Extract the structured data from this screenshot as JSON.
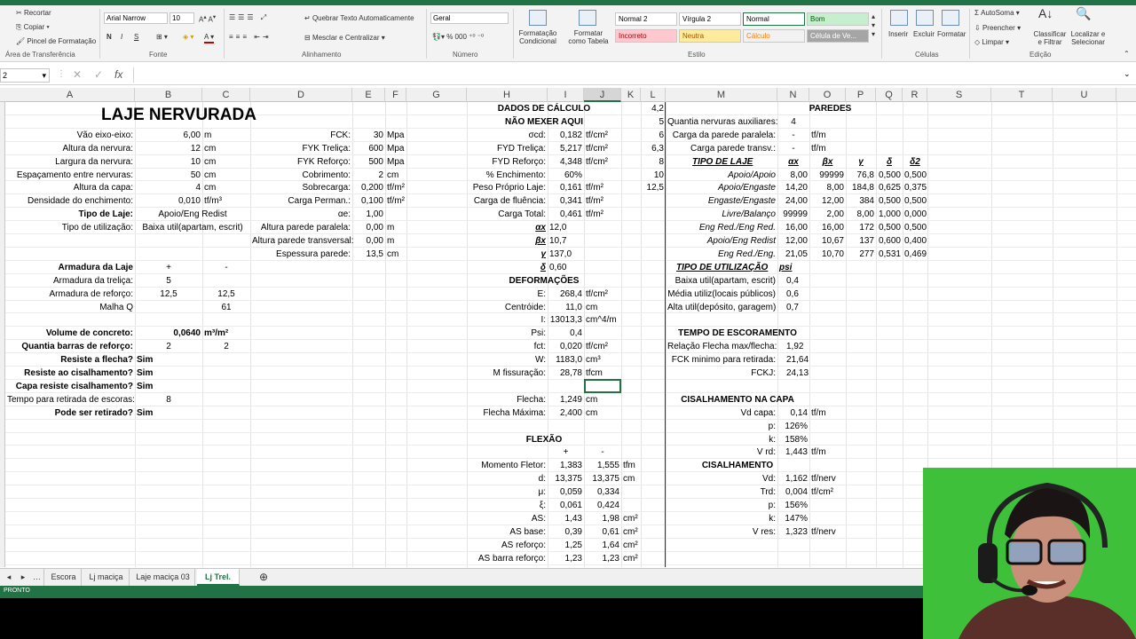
{
  "ribbon": {
    "clipboard": {
      "cut": "Recortar",
      "copy": "Copiar",
      "paste_fmt": "Pincel de Formatação",
      "label": "Área de Transferência"
    },
    "font": {
      "name": "Arial Narrow",
      "size": "10",
      "label": "Fonte",
      "bold": "N",
      "italic": "I",
      "underline": "S"
    },
    "alignment": {
      "wrap": "Quebrar Texto Automaticamente",
      "merge": "Mesclar e Centralizar",
      "label": "Alinhamento"
    },
    "number": {
      "format": "Geral",
      "percent": "%",
      "label": "Número"
    },
    "styles": {
      "cond": "Formatação Condicional",
      "table": "Formatar como Tabela",
      "label": "Estilo",
      "cells": [
        {
          "text": "Normal 2",
          "bg": "#ffffff",
          "fg": "#000000"
        },
        {
          "text": "Vírgula 2",
          "bg": "#ffffff",
          "fg": "#000000"
        },
        {
          "text": "Normal",
          "bg": "#ffffff",
          "fg": "#000000"
        },
        {
          "text": "Bom",
          "bg": "#c6efce",
          "fg": "#006100"
        },
        {
          "text": "Incorreto",
          "bg": "#ffc7ce",
          "fg": "#9c0006"
        },
        {
          "text": "Neutra",
          "bg": "#ffeb9c",
          "fg": "#9c5700"
        },
        {
          "text": "Cálculo",
          "bg": "#f2f2f2",
          "fg": "#fa7d00"
        },
        {
          "text": "Célula de Ve...",
          "bg": "#a5a5a5",
          "fg": "#ffffff"
        }
      ]
    },
    "cells_grp": {
      "insert": "Inserir",
      "delete": "Excluir",
      "format": "Formatar",
      "label": "Células"
    },
    "editing": {
      "autosum": "AutoSoma",
      "fill": "Preencher",
      "clear": "Limpar",
      "sort": "Classificar e Filtrar",
      "find": "Localizar e Selecionar",
      "label": "Edição"
    }
  },
  "formula_bar": {
    "namebox": "2",
    "fx": "fx",
    "content": ""
  },
  "columns": [
    "A",
    "B",
    "C",
    "D",
    "E",
    "F",
    "G",
    "H",
    "I",
    "J",
    "K",
    "L",
    "M",
    "N",
    "O",
    "P",
    "Q",
    "R",
    "S",
    "T",
    "U"
  ],
  "sheet": {
    "title": "LAJE NERVURADA",
    "left_labels": [
      "Vão eixo-eixo:",
      "Altura da nervura:",
      "Largura da nervura:",
      "Espaçamento entre nervuras:",
      "Altura da capa:",
      "Densidade do enchimento:",
      "Tipo de Laje:",
      "Tipo de utilização:"
    ],
    "left_values": [
      "6,00",
      "12",
      "10",
      "50",
      "4",
      "0,010",
      "Apoio/Eng Redist",
      "Baixa util(apartam, escrit)"
    ],
    "left_units": [
      "m",
      "cm",
      "cm",
      "cm",
      "cm",
      "tf/m³",
      "",
      ""
    ],
    "mid_labels": [
      "FCK:",
      "FYK Treliça:",
      "FYK Reforço:",
      "Cobrimento:",
      "Sobrecarga:",
      "Carga Perman.:",
      "αe:",
      "Altura parede paralela:",
      "Altura parede transversal:",
      "Espessura parede:"
    ],
    "mid_values": [
      "30",
      "600",
      "500",
      "2",
      "0,200",
      "0,100",
      "1,00",
      "0,00",
      "0,00",
      "13,5"
    ],
    "mid_units": [
      "Mpa",
      "Mpa",
      "Mpa",
      "cm",
      "tf/m²",
      "tf/m²",
      "",
      "m",
      "m",
      "cm"
    ],
    "armadura": {
      "title": "Armadura da Laje",
      "plus": "+",
      "minus": "-",
      "rows": [
        {
          "label": "Armadura da treliça:",
          "b": "5",
          "c": ""
        },
        {
          "label": "Armadura de reforço:",
          "b": "12,5",
          "c": "12,5"
        },
        {
          "label": "Malha Q",
          "b": "",
          "c": "61"
        }
      ]
    },
    "results": [
      {
        "label": "Volume de concreto:",
        "b": "0,0640",
        "c": "m³/m²"
      },
      {
        "label": "Quantia barras de reforço:",
        "b": "2",
        "c": "2"
      },
      {
        "label": "Resiste a flecha?",
        "b": "Sim",
        "c": ""
      },
      {
        "label": "Resiste ao cisalhamento?",
        "b": "Sim",
        "c": ""
      },
      {
        "label": "Capa resiste cisalhamento?",
        "b": "Sim",
        "c": ""
      },
      {
        "label": "Tempo para retirada de escoras:",
        "b": "8",
        "c": ""
      },
      {
        "label": "Pode ser retirado?",
        "b": "Sim",
        "c": ""
      }
    ],
    "calc": {
      "title1": "DADOS DE CÁLCULO",
      "title2": "NÃO MEXER AQUI",
      "rows": [
        {
          "label": "σcd:",
          "v": "0,182",
          "u": "tf/cm²"
        },
        {
          "label": "FYD Treliça:",
          "v": "5,217",
          "u": "tf/cm²"
        },
        {
          "label": "FYD Reforço:",
          "v": "4,348",
          "u": "tf/cm²"
        },
        {
          "label": "% Enchimento:",
          "v": "60%",
          "u": ""
        },
        {
          "label": "Peso Próprio Laje:",
          "v": "0,161",
          "u": "tf/m²"
        },
        {
          "label": "Carga de fluência:",
          "v": "0,341",
          "u": "tf/m²"
        },
        {
          "label": "Carga Total:",
          "v": "0,461",
          "u": "tf/m²"
        },
        {
          "label": "αx",
          "v": "12,0",
          "u": ""
        },
        {
          "label": "βx",
          "v": "10,7",
          "u": ""
        },
        {
          "label": "γ",
          "v": "137,0",
          "u": ""
        },
        {
          "label": "δ",
          "v": "0,60",
          "u": ""
        }
      ]
    },
    "deform": {
      "title": "DEFORMAÇÕES",
      "rows": [
        {
          "label": "E:",
          "v": "268,4",
          "u": "tf/cm²"
        },
        {
          "label": "Centróide:",
          "v": "11,0",
          "u": "cm"
        },
        {
          "label": "I:",
          "v": "13013,3",
          "u": "cm^4/m"
        },
        {
          "label": "Psi:",
          "v": "0,4",
          "u": ""
        },
        {
          "label": "fct:",
          "v": "0,020",
          "u": "tf/cm²"
        },
        {
          "label": "W:",
          "v": "1183,0",
          "u": "cm³"
        },
        {
          "label": "M fissuração:",
          "v": "28,78",
          "u": "tfcm"
        },
        {
          "label": "",
          "v": "",
          "u": ""
        },
        {
          "label": "Flecha:",
          "v": "1,249",
          "u": "cm"
        },
        {
          "label": "Flecha Máxima:",
          "v": "2,400",
          "u": "cm"
        }
      ]
    },
    "flexao": {
      "title": "FLEXÃO",
      "plus": "+",
      "minus": "-",
      "rows": [
        {
          "label": "Momento Fletor:",
          "i": "1,383",
          "j": "1,555",
          "u": "tfm"
        },
        {
          "label": "d:",
          "i": "13,375",
          "j": "13,375",
          "u": "cm"
        },
        {
          "label": "μ:",
          "i": "0,059",
          "j": "0,334",
          "u": ""
        },
        {
          "label": "ξ:",
          "i": "0,061",
          "j": "0,424",
          "u": ""
        },
        {
          "label": "AS:",
          "i": "1,43",
          "j": "1,98",
          "u": "cm²"
        },
        {
          "label": "AS base:",
          "i": "0,39",
          "j": "0,61",
          "u": "cm²"
        },
        {
          "label": "AS reforço:",
          "i": "1,25",
          "j": "1,64",
          "u": "cm²"
        },
        {
          "label": "AS barra reforço:",
          "i": "1,23",
          "j": "1,23",
          "u": "cm²"
        }
      ]
    },
    "kl": [
      "4,2",
      "5",
      "6",
      "6,3",
      "8",
      "10",
      "12,5"
    ],
    "paredes": {
      "title": "PAREDES",
      "rows": [
        {
          "label": "Quantia nervuras auxiliares:",
          "v": "4",
          "u": ""
        },
        {
          "label": "Carga da parede paralela:",
          "v": "-",
          "u": "tf/m"
        },
        {
          "label": "Carga parede transv.:",
          "v": "-",
          "u": "tf/m"
        }
      ]
    },
    "tipo_laje": {
      "title": "TIPO DE LAJE",
      "headers": [
        "αx",
        "βx",
        "γ",
        "δ",
        "δ2"
      ],
      "rows": [
        {
          "label": "Apoio/Apoio",
          "v": [
            "8,00",
            "99999",
            "76,8",
            "0,500",
            "0,500"
          ]
        },
        {
          "label": "Apoio/Engaste",
          "v": [
            "14,20",
            "8,00",
            "184,8",
            "0,625",
            "0,375"
          ]
        },
        {
          "label": "Engaste/Engaste",
          "v": [
            "24,00",
            "12,00",
            "384",
            "0,500",
            "0,500"
          ]
        },
        {
          "label": "Livre/Balanço",
          "v": [
            "99999",
            "2,00",
            "8,00",
            "1,000",
            "0,000"
          ]
        },
        {
          "label": "Eng Red./Eng Red.",
          "v": [
            "16,00",
            "16,00",
            "172",
            "0,500",
            "0,500"
          ]
        },
        {
          "label": "Apoio/Eng Redist",
          "v": [
            "12,00",
            "10,67",
            "137",
            "0,600",
            "0,400"
          ]
        },
        {
          "label": "Eng Red./Eng.",
          "v": [
            "21,05",
            "10,70",
            "277",
            "0,531",
            "0,469"
          ]
        }
      ]
    },
    "tipo_util": {
      "title": "TIPO DE UTILIZAÇÃO",
      "header": "psi",
      "rows": [
        {
          "label": "Baixa util(apartam, escrit)",
          "v": "0,4"
        },
        {
          "label": "Média utiliz(locais públicos)",
          "v": "0,6"
        },
        {
          "label": "Alta util(depósito, garagem)",
          "v": "0,7"
        }
      ]
    },
    "escoramento": {
      "title": "TEMPO DE ESCORAMENTO",
      "rows": [
        {
          "label": "Relação Flecha max/flecha:",
          "v": "1,92",
          "u": ""
        },
        {
          "label": "FCK minimo para retirada:",
          "v": "21,64",
          "u": ""
        },
        {
          "label": "FCKJ:",
          "v": "24,13",
          "u": ""
        }
      ]
    },
    "cis_capa": {
      "title": "CISALHAMENTO NA CAPA",
      "rows": [
        {
          "label": "Vd capa:",
          "v": "0,14",
          "u": "tf/m"
        },
        {
          "label": "p:",
          "v": "126%",
          "u": ""
        },
        {
          "label": "k:",
          "v": "158%",
          "u": ""
        },
        {
          "label": "V rd:",
          "v": "1,443",
          "u": "tf/m"
        }
      ]
    },
    "cis": {
      "title": "CISALHAMENTO",
      "rows": [
        {
          "label": "Vd:",
          "v": "1,162",
          "u": "tf/nerv"
        },
        {
          "label": "Trd:",
          "v": "0,004",
          "u": "tf/cm²"
        },
        {
          "label": "p:",
          "v": "156%",
          "u": ""
        },
        {
          "label": "k:",
          "v": "147%",
          "u": ""
        },
        {
          "label": "V res:",
          "v": "1,323",
          "u": "tf/nerv"
        }
      ]
    }
  },
  "sheet_tabs": [
    "Escora",
    "Lj maciça",
    "Laje maciça 03",
    "Lj Trel."
  ],
  "active_tab": "Lj Trel.",
  "status": "PRONTO",
  "colors": {
    "excel_green": "#217346",
    "webcam_green": "#3fc03b"
  }
}
